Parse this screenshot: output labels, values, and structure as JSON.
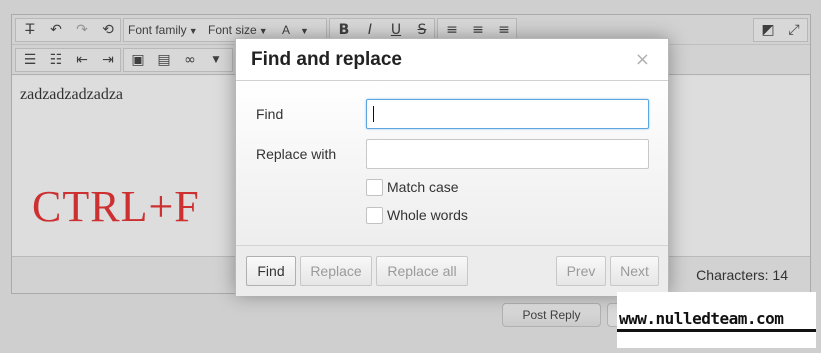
{
  "toolbar": {
    "font_family_label": "Font family",
    "font_size_label": "Font size",
    "text_color_glyph": "A",
    "bold_glyph": "B",
    "italic_glyph": "I",
    "underline_glyph": "U",
    "strike_glyph": "S",
    "icons": [
      "clear-formatting-icon",
      "undo-icon",
      "redo-icon",
      "restore-draft-icon",
      "text-color-icon",
      "bold-icon",
      "italic-icon",
      "underline-icon",
      "strikethrough-icon",
      "align-left-icon",
      "align-center-icon",
      "align-right-icon",
      "fullscreen-toggle-icon",
      "expand-icon",
      "bullet-list-icon",
      "numbered-list-icon",
      "outdent-icon",
      "indent-icon",
      "image-icon",
      "media-icon",
      "link-icon"
    ]
  },
  "editor": {
    "content_text": "zadzadzadzadza",
    "overlay_caption": "CTRL+F",
    "overlay_caption_color": "#e02020"
  },
  "status": {
    "characters_label": "Characters: 14"
  },
  "page": {
    "post_reply_label": "Post Reply"
  },
  "dialog": {
    "title": "Find and replace",
    "close_glyph": "×",
    "find_label": "Find",
    "find_value": "",
    "replace_label": "Replace with",
    "replace_value": "",
    "match_case_label": "Match case",
    "match_case_checked": false,
    "whole_words_label": "Whole words",
    "whole_words_checked": false,
    "buttons": {
      "find": "Find",
      "replace": "Replace",
      "replace_all": "Replace all",
      "prev": "Prev",
      "next": "Next"
    },
    "focus_color": "#5ba5e0"
  },
  "watermark": {
    "text": "www.nulledteam.com"
  }
}
